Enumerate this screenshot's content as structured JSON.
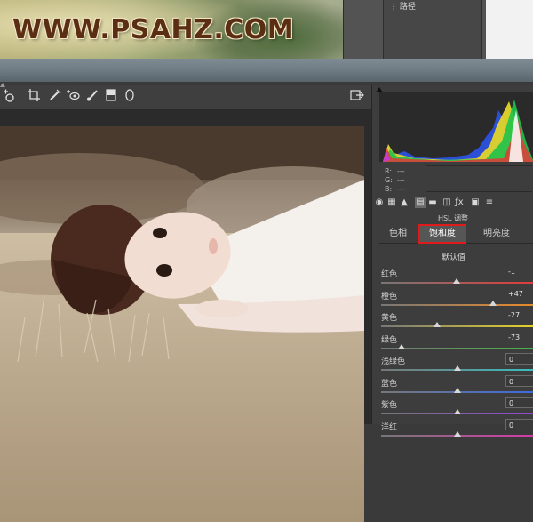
{
  "banner": {
    "watermark": "WWW.PSAHZ.COM",
    "layer_name": "路径"
  },
  "toolbar": {
    "tools": [
      {
        "name": "target-adjust-icon",
        "glyph": "⊹"
      },
      {
        "name": "crop-icon",
        "glyph": "⌗"
      },
      {
        "name": "spot-removal-icon",
        "glyph": "✎"
      },
      {
        "name": "red-eye-icon",
        "glyph": "👁"
      },
      {
        "name": "brush-icon",
        "glyph": "🖌"
      },
      {
        "name": "graduated-filter-icon",
        "glyph": "▮"
      },
      {
        "name": "radial-filter-icon",
        "glyph": "○"
      },
      {
        "name": "open-preferences-icon",
        "glyph": "⇱"
      }
    ]
  },
  "readout": {
    "r_label": "R:",
    "r_value": "---",
    "g_label": "G:",
    "g_value": "---",
    "b_label": "B:",
    "b_value": "---"
  },
  "panel": {
    "title": "HSL 调整",
    "tabs": [
      "色相",
      "饱和度",
      "明亮度"
    ],
    "active_tab": "饱和度",
    "default_link": "默认值",
    "sliders": [
      {
        "label": "红色",
        "value": "-1",
        "level": -1,
        "color": "#e23b3b",
        "boxed": false
      },
      {
        "label": "橙色",
        "value": "+47",
        "level": 47,
        "color": "#e88a2a",
        "boxed": false
      },
      {
        "label": "黄色",
        "value": "-27",
        "level": -27,
        "color": "#e5d12b",
        "boxed": false
      },
      {
        "label": "绿色",
        "value": "-73",
        "level": -73,
        "color": "#49b34a",
        "boxed": false
      },
      {
        "label": "浅绿色",
        "value": "0",
        "level": 0,
        "color": "#39bdbf",
        "boxed": true
      },
      {
        "label": "蓝色",
        "value": "0",
        "level": 0,
        "color": "#3c6be0",
        "boxed": true
      },
      {
        "label": "紫色",
        "value": "0",
        "level": 0,
        "color": "#8e48d6",
        "boxed": true
      },
      {
        "label": "洋红",
        "value": "0",
        "level": 0,
        "color": "#d63aa8",
        "boxed": true
      }
    ]
  },
  "colors": {
    "accent_highlight": "#e0191c",
    "panel_bg": "#3d3d3d"
  }
}
